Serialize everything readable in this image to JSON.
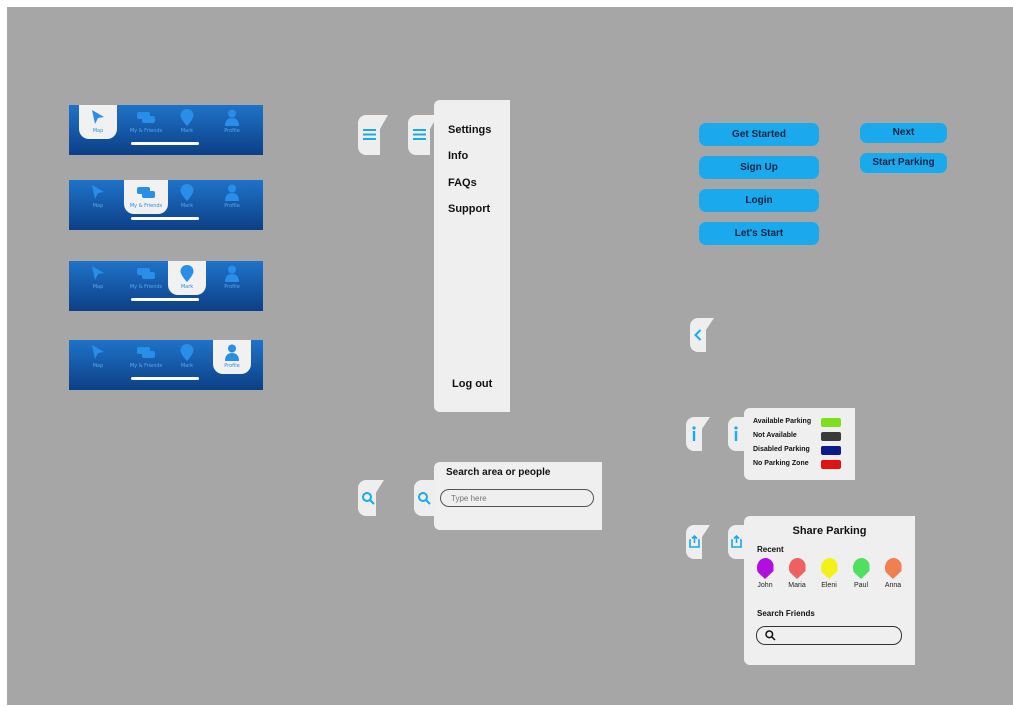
{
  "tabbars": [
    {
      "active": 0
    },
    {
      "active": 1
    },
    {
      "active": 2
    },
    {
      "active": 3
    }
  ],
  "tab_labels": [
    "Map",
    "My & Friends",
    "Mark",
    "Profile"
  ],
  "menu": {
    "items": [
      "Settings",
      "Info",
      "FAQs",
      "Support"
    ],
    "logout": "Log out"
  },
  "search": {
    "title": "Search area or people",
    "placeholder": "Type here"
  },
  "buttons": {
    "get_started": "Get Started",
    "sign_up": "Sign Up",
    "login": "Login",
    "lets_start": "Let's Start",
    "next": "Next",
    "start_parking": "Start Parking"
  },
  "legend": {
    "items": [
      {
        "label": "Available Parking",
        "color": "#7fe01a"
      },
      {
        "label": "Not Available",
        "color": "#3a3a3a"
      },
      {
        "label": "Disabled Parking",
        "color": "#0c1a8a"
      },
      {
        "label": "No Parking Zone",
        "color": "#e31212"
      }
    ]
  },
  "share": {
    "title": "Share Parking",
    "recent_label": "Recent",
    "friends": [
      {
        "name": "John",
        "color": "#b10fe0"
      },
      {
        "name": "Maria",
        "color": "#f06060"
      },
      {
        "name": "Eleni",
        "color": "#f4f01a"
      },
      {
        "name": "Paul",
        "color": "#50e060"
      },
      {
        "name": "Anna",
        "color": "#f08050"
      }
    ],
    "search_label": "Search Friends"
  },
  "colors": {
    "accent": "#19a9ec",
    "bar_top": "#1f73c9",
    "bar_bottom": "#0c3f86"
  }
}
